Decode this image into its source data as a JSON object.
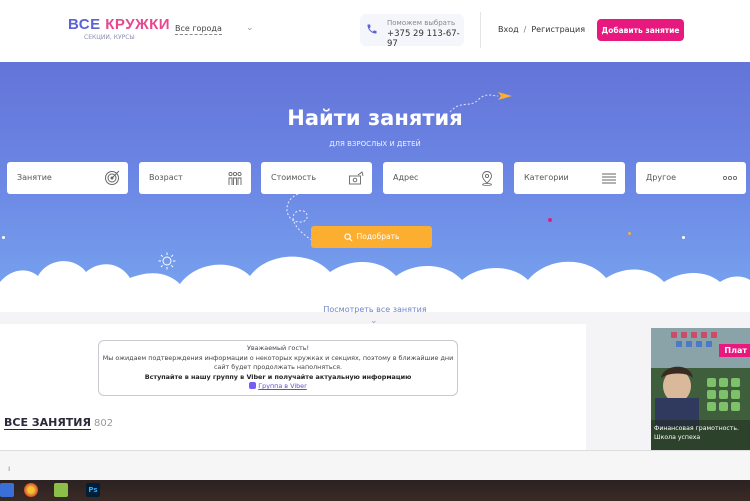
{
  "header": {
    "logo_part1": "ВСЕ ",
    "logo_part2": "КРУЖКИ",
    "logo_sub": "СЕКЦИИ, КУРСЫ",
    "city": "Все города",
    "help_label": "Поможем выбрать",
    "help_phone": "+375 29 113-67-97",
    "login": "Вход",
    "separator": "/",
    "register": "Регистрация",
    "add_button": "Добавить занятие"
  },
  "hero": {
    "title": "Найти занятия",
    "subtitle": "ДЛЯ ВЗРОСЛЫХ И ДЕТЕЙ",
    "fields": [
      {
        "label": "Занятие",
        "icon": "target-icon"
      },
      {
        "label": "Возраст",
        "icon": "people-icon"
      },
      {
        "label": "Стоимость",
        "icon": "money-icon"
      },
      {
        "label": "Адрес",
        "icon": "location-icon"
      },
      {
        "label": "Категории",
        "icon": "list-icon"
      },
      {
        "label": "Другое",
        "icon": "more-icon"
      }
    ],
    "find_button": "Подобрать"
  },
  "see_all": "Посмотреть все занятия",
  "notice": {
    "line1": "Уважаемый гость!",
    "line2": "Мы ожидаем подтверждения информации о некоторых кружках и секциях, поэтому в ближайшие дни",
    "line3": "сайт будет продолжать наполняться.",
    "line4": "Вступайте в нашу группу в Viber и получайте актуальную информацию",
    "viber_link": "Группа в Viber"
  },
  "all_section": {
    "title": "ВСЕ ЗАНЯТИЯ",
    "count": "802"
  },
  "ad": {
    "badge": "Плат",
    "text_line1": "Финансовая грамотность.",
    "text_line2": "Школа успеха"
  },
  "colors": {
    "accent_pink": "#e8197e",
    "hero_blue": "#6b86e4",
    "button_orange": "#fbae2f"
  }
}
